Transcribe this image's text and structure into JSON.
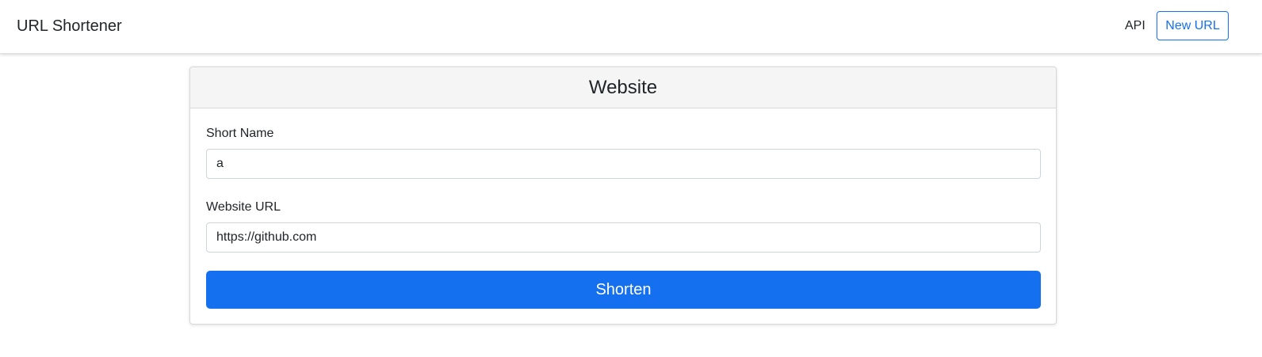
{
  "navbar": {
    "brand": "URL Shortener",
    "links": [
      {
        "label": "API"
      },
      {
        "label": "New URL"
      }
    ]
  },
  "card": {
    "title": "Website",
    "fields": {
      "short_name": {
        "label": "Short Name",
        "value": "a"
      },
      "website_url": {
        "label": "Website URL",
        "value": "https://github.com"
      }
    },
    "submit_label": "Shorten"
  },
  "colors": {
    "primary": "#1570ef",
    "header_bg": "#f5f5f5",
    "border": "#d8d8d8"
  }
}
